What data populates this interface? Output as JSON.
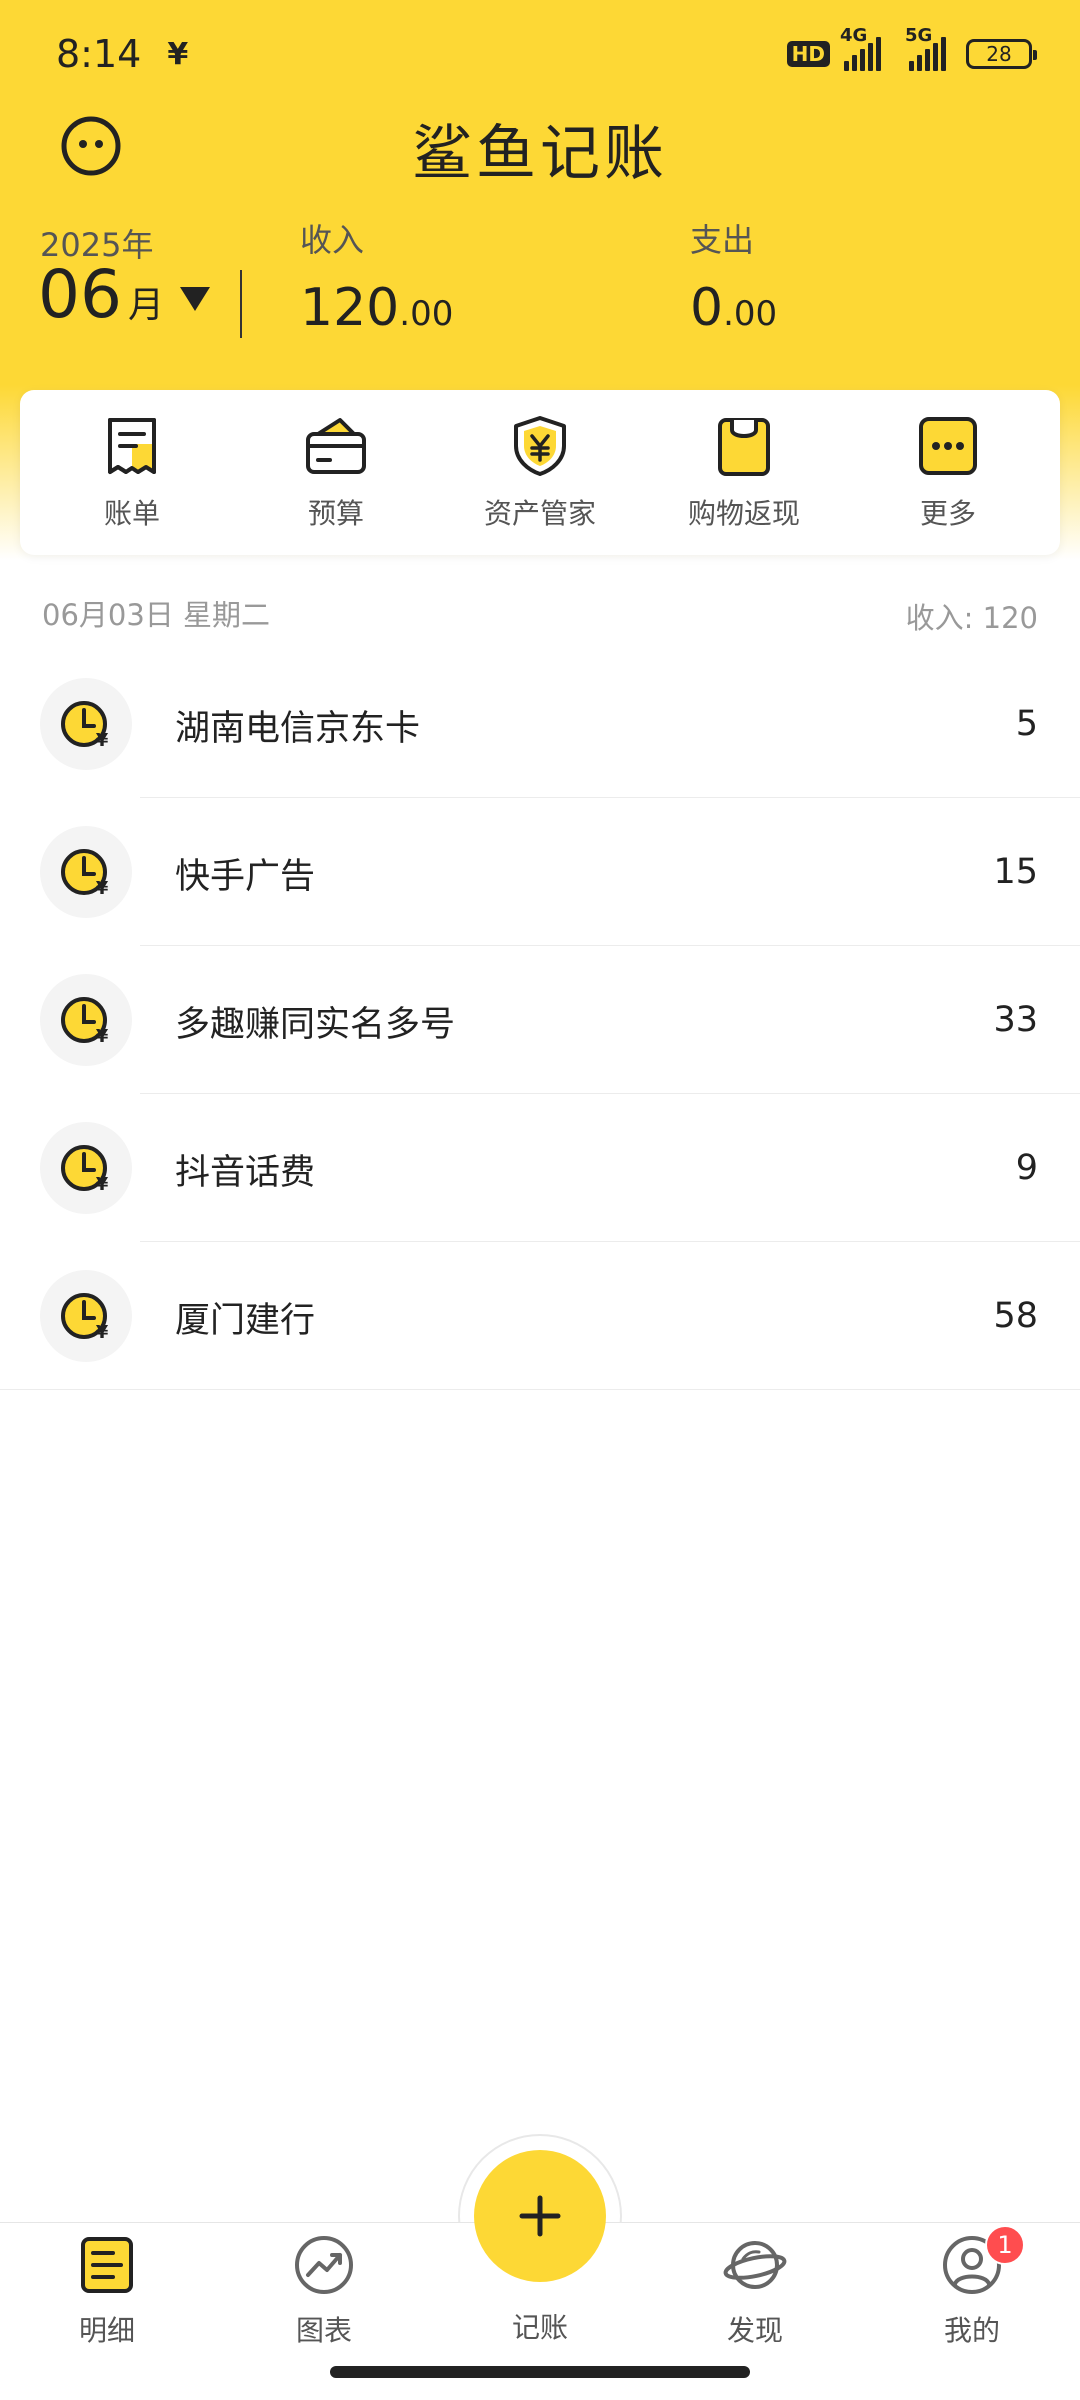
{
  "status_bar": {
    "time": "8:14",
    "notification_icon": "yen-icon",
    "hd_label": "HD",
    "network_1": "4G",
    "network_2": "5G",
    "battery": "28"
  },
  "header": {
    "title": "鲨鱼记账",
    "year": "2025年",
    "month": "06",
    "month_unit": "月",
    "income_label": "收入",
    "income_int": "120",
    "income_dec": ".00",
    "expense_label": "支出",
    "expense_int": "0",
    "expense_dec": ".00"
  },
  "quick_menu": {
    "items": [
      {
        "label": "账单",
        "icon": "bill-icon"
      },
      {
        "label": "预算",
        "icon": "budget-wallet-icon"
      },
      {
        "label": "资产管家",
        "icon": "asset-shield-icon"
      },
      {
        "label": "购物返现",
        "icon": "shopping-bag-icon"
      },
      {
        "label": "更多",
        "icon": "more-icon"
      }
    ]
  },
  "day": {
    "date": "06月03日 星期二",
    "income_label": "收入:",
    "income_value": "120"
  },
  "records": [
    {
      "name": "湖南电信京东卡",
      "amount": "5"
    },
    {
      "name": "快手广告",
      "amount": "15"
    },
    {
      "name": "多趣赚同实名多号",
      "amount": "33"
    },
    {
      "name": "抖音话费",
      "amount": "9"
    },
    {
      "name": "厦门建行",
      "amount": "58"
    }
  ],
  "bottom_nav": {
    "items": [
      {
        "label": "明细",
        "icon": "detail-icon"
      },
      {
        "label": "图表",
        "icon": "chart-icon"
      },
      {
        "label": "记账",
        "icon": "plus-icon"
      },
      {
        "label": "发现",
        "icon": "planet-icon"
      },
      {
        "label": "我的",
        "icon": "profile-icon"
      }
    ],
    "badge_count": "1"
  },
  "colors": {
    "brand_yellow": "#fdd835",
    "text_dark": "#222222",
    "badge_red": "#ff4d4f"
  }
}
